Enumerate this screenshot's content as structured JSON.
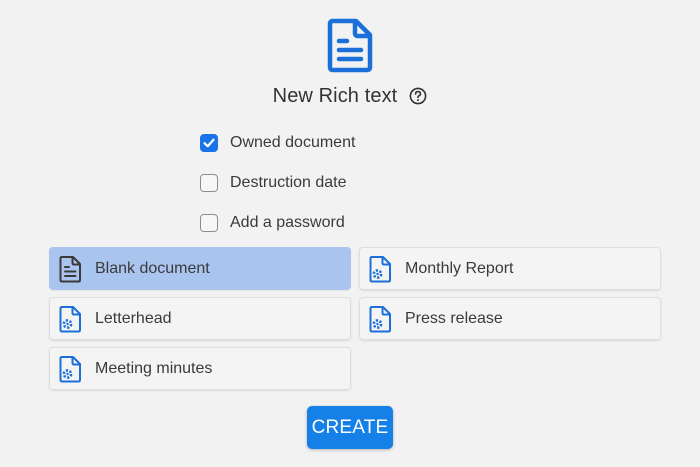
{
  "header": {
    "icon": "rich-text-document-icon",
    "title": "New Rich text",
    "help_icon": "question-circle-icon"
  },
  "options": [
    {
      "label": "Owned document",
      "checked": true
    },
    {
      "label": "Destruction date",
      "checked": false
    },
    {
      "label": "Add a password",
      "checked": false
    }
  ],
  "templates": [
    {
      "label": "Blank document",
      "icon": "document-lines-icon",
      "selected": true
    },
    {
      "label": "Monthly Report",
      "icon": "document-gear-icon",
      "selected": false
    },
    {
      "label": "Letterhead",
      "icon": "document-gear-icon",
      "selected": false
    },
    {
      "label": "Press release",
      "icon": "document-gear-icon",
      "selected": false
    },
    {
      "label": "Meeting minutes",
      "icon": "document-gear-icon",
      "selected": false
    }
  ],
  "actions": {
    "create_label": "CREATE"
  },
  "colors": {
    "accent": "#1a73e8",
    "selected_template": "#a9c4ef",
    "background": "#f2f2f2"
  }
}
